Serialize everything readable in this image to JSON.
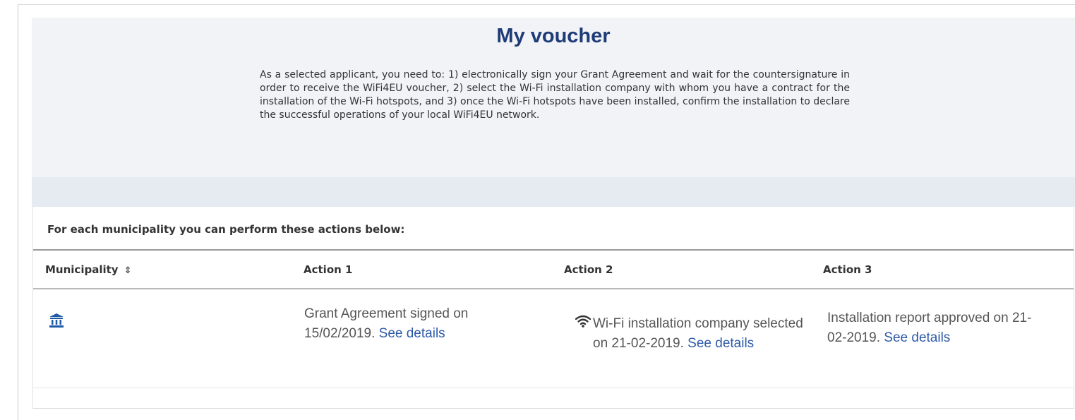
{
  "page": {
    "title": "My voucher",
    "intro": "As a selected applicant, you need to: 1) electronically sign your Grant Agreement and wait for the countersignature in order to receive the WiFi4EU voucher, 2) select the Wi-Fi installation company with whom you have a contract for the installation of the Wi-Fi hotspots, and 3) once the Wi-Fi hotspots have been installed, confirm the installation to declare the successful operations of your local WiFi4EU network."
  },
  "table": {
    "instruction": "For each municipality you can perform these actions below:",
    "headers": {
      "municipality": "Municipality",
      "action1": "Action 1",
      "action2": "Action 2",
      "action3": "Action 3"
    },
    "sort_icon": "⇕",
    "rows": [
      {
        "municipality_icon": "municipality-building-icon",
        "action1_text": "Grant Agreement signed on 15/02/2019.",
        "action1_link": "See details",
        "action2_icon": "wifi-icon",
        "action2_text": "Wi-Fi installation company selected on 21-02-2019.",
        "action2_link": "See details",
        "action3_text": "Installation report approved on 21-02-2019.",
        "action3_link": "See details"
      }
    ]
  },
  "colors": {
    "title": "#1f3c78",
    "link": "#2e5aa8",
    "header_bg": "#f1f3f6",
    "strip_bg": "#e6ebf1"
  }
}
